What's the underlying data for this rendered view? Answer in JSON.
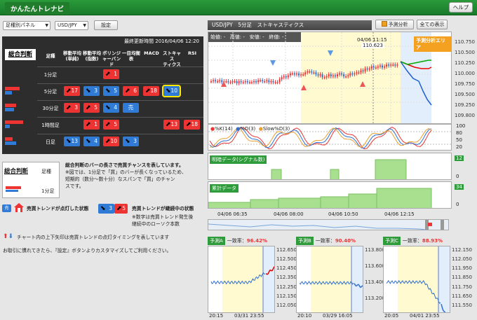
{
  "app": {
    "title": "かんたんトレナビ",
    "help_label": "ヘルプ"
  },
  "toolbar": {
    "panel_select": "足種別パネル",
    "pair_select": "USD/JPY",
    "settings_label": "設定",
    "chart_title": "USD/JPY　5分足　ストキャスティクス",
    "forecast_checkbox_label": "予測分析",
    "forecast_checked": true,
    "show_all_label": "全ての表示"
  },
  "grid": {
    "updated": "最終更新時間 2016/04/06 12:20",
    "summary_label": "総合判断",
    "timeframe_header": "足種",
    "columns": [
      "移動平均\n(単純)",
      "移動平均\n(指数)",
      "ボリンジ\nャーバンド",
      "一目均衡\n表",
      "MACD",
      "ストキャス\nティクス",
      "RSI"
    ],
    "rows": [
      {
        "label": "1分足",
        "strength": 0,
        "cells": [
          null,
          null,
          {
            "dir": "up",
            "val": "1"
          },
          null,
          null,
          null,
          null
        ]
      },
      {
        "label": "5分足",
        "strength": 3,
        "cells": [
          {
            "dir": "up",
            "val": "17"
          },
          {
            "dir": "down",
            "val": "3"
          },
          {
            "dir": "down",
            "val": "5"
          },
          {
            "dir": "up",
            "val": "6"
          },
          {
            "dir": "up",
            "val": "18"
          },
          {
            "dir": "down",
            "val": "10",
            "selected": true
          },
          null
        ]
      },
      {
        "label": "30分足",
        "strength": 2,
        "cells": [
          {
            "dir": "up",
            "val": "3"
          },
          {
            "dir": "up",
            "val": "5"
          },
          {
            "dir": "down",
            "val": "4"
          },
          {
            "dir": "sell",
            "val": "売"
          },
          null,
          null,
          null
        ]
      },
      {
        "label": "1時間足",
        "strength": 4,
        "cells": [
          null,
          {
            "dir": "up",
            "val": "1"
          },
          {
            "dir": "up",
            "val": "5"
          },
          null,
          null,
          {
            "dir": "up",
            "val": "13"
          },
          {
            "dir": "up",
            "val": "18"
          }
        ]
      },
      {
        "label": "日足",
        "strength": 1,
        "cells": [
          {
            "dir": "down",
            "val": "13"
          },
          {
            "dir": "down",
            "val": "4"
          },
          {
            "dir": "up",
            "val": "10"
          },
          {
            "dir": "down",
            "val": "3"
          },
          null,
          null,
          null
        ]
      }
    ]
  },
  "legend": {
    "summary_label": "総合判断",
    "timeframe_label": "足種",
    "example_tf": "1分足",
    "desc_lines": [
      "総合判断のバーの長さで売買チャンスを表しています。",
      "※図では、1分足で「買」のバーが長くなっているため、",
      "短期的（数分〜数十分）なスパンで「買」のチャン",
      "スです。"
    ],
    "lit_label": "売買トレンドが点灯した状態",
    "cont_label": "売買トレンドが継続中の状態",
    "cont_note1": "※数字は売買トレンド発生後",
    "cont_note2": "継続中のローソク本数",
    "arrow_note": "チャート内の上下矢印は売買トレンドの点灯タイミングを表しています",
    "custom_note": "お取引に慣れてきたら、『設定』ボタンよりカスタマイズしてご利用ください。",
    "cell_5": "5"
  },
  "main_chart": {
    "ohlc": {
      "open": "始値: -",
      "high": "高値: -",
      "low": "安値: -",
      "close": "終値: -"
    },
    "hover_time": "04/06 11:15",
    "hover_value": "110.623",
    "forecast_area_label": "予測分析エリア",
    "y_labels": [
      "110.750",
      "110.500",
      "110.250",
      "110.000",
      "109.750",
      "109.500",
      "109.250",
      "109.800"
    ],
    "x_labels": [
      "04/06 06:35",
      "04/06 08:00",
      "04/06 10:50",
      "04/06 12:15"
    ]
  },
  "stoch": {
    "k_label": "%K(14)",
    "d_label": "%D(3)",
    "sd_label": "Slow%D(3)",
    "y_labels": [
      "100",
      "80",
      "50",
      "20",
      "0"
    ]
  },
  "signal_panel": {
    "title": "明暗データ(シグナル数)",
    "value": "12",
    "y0": "0"
  },
  "cumul_panel": {
    "title": "累計データ",
    "value": "34",
    "y0": "0"
  },
  "forecasts": [
    {
      "name": "予測A",
      "rate_label": "一致率：",
      "rate": "96.42%",
      "y_labels": [
        "112.650",
        "112.500",
        "112.450",
        "112.350",
        "112.250",
        "112.150",
        "112.050"
      ],
      "x_labels": [
        "20:15",
        "03/31 23:55"
      ]
    },
    {
      "name": "予測B",
      "rate_label": "一致率：",
      "rate": "90.40%",
      "y_labels": [
        "113.800",
        "113.600",
        "113.400",
        "113.200"
      ],
      "x_labels": [
        "20:10",
        "03/29 16:05"
      ]
    },
    {
      "name": "予測C",
      "rate_label": "一致率：",
      "rate": "88.93%",
      "y_labels": [
        "112.150",
        "112.050",
        "111.950",
        "111.850",
        "111.750",
        "111.650",
        "111.550"
      ],
      "x_labels": [
        "20:05",
        "04/01 23:55"
      ]
    }
  ],
  "colors": {
    "buy": "#e33333",
    "sell": "#2f7bd6",
    "accent": "#2e9c3a"
  }
}
